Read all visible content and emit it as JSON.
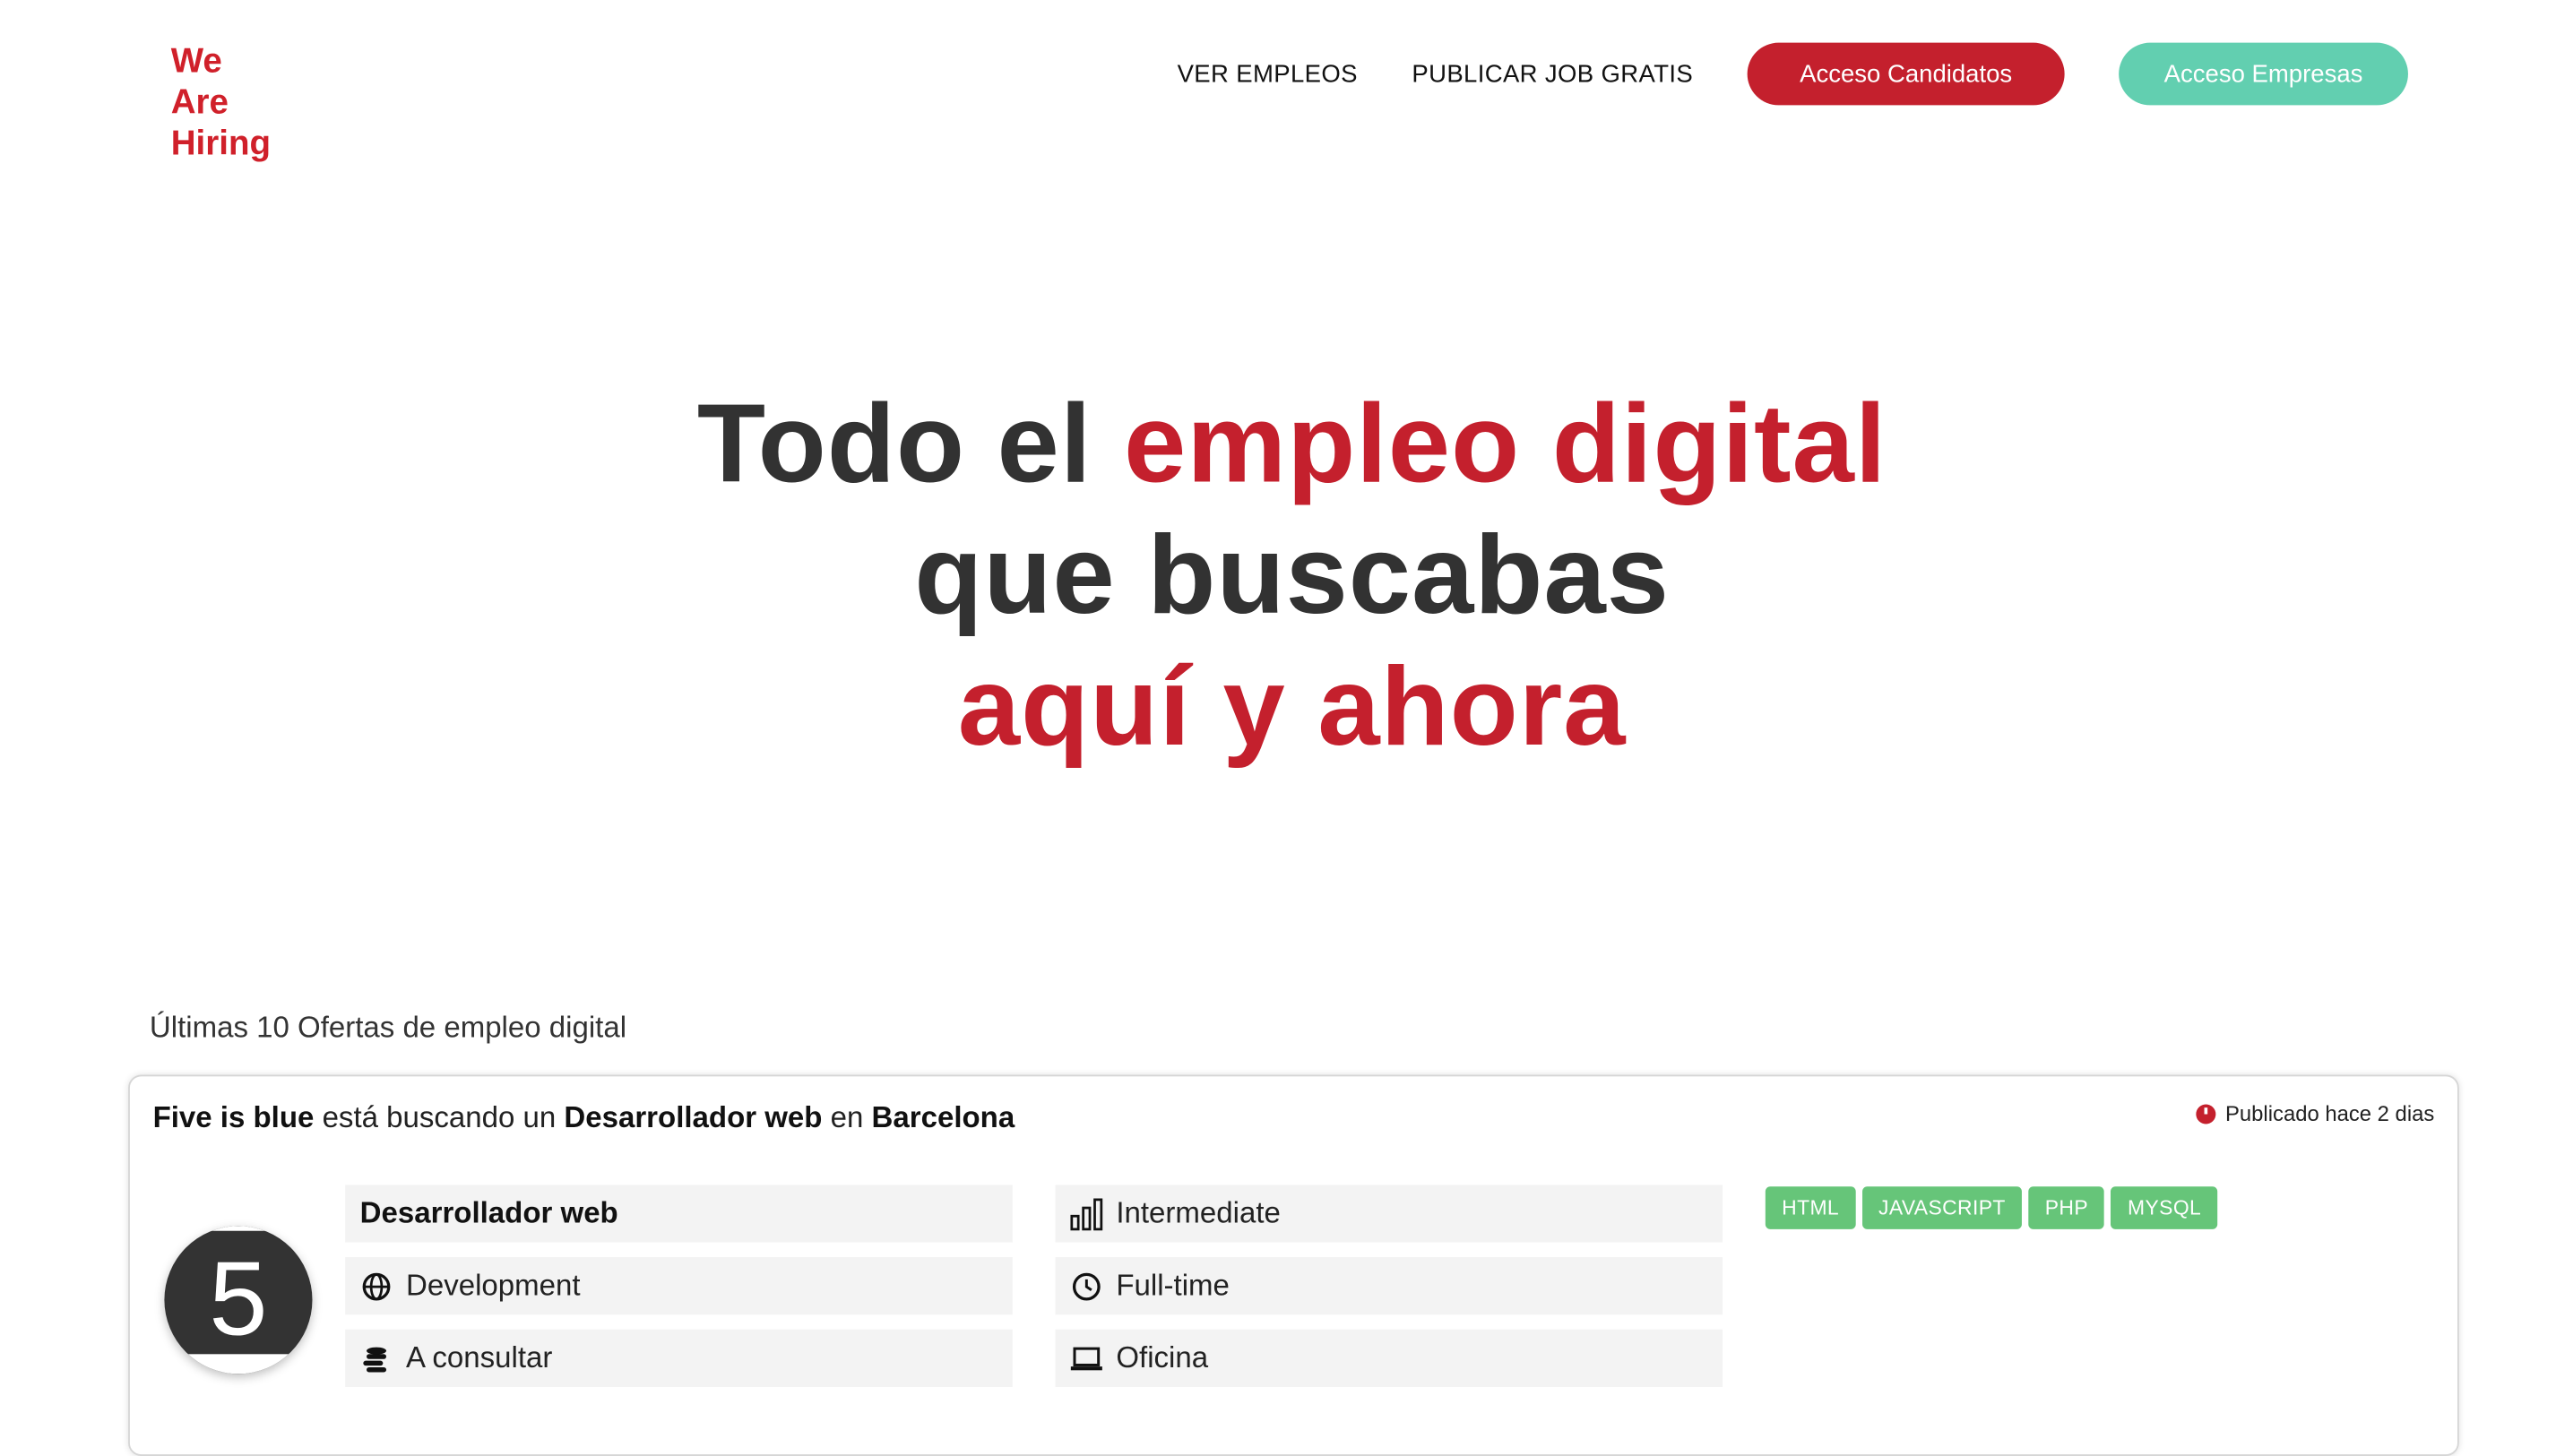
{
  "logo": {
    "line1": "We",
    "line2": "Are",
    "line3": "Hiring"
  },
  "nav": {
    "link1": "VER EMPLEOS",
    "link2": "PUBLICAR JOB GRATIS",
    "btn_candidates": "Acceso Candidatos",
    "btn_companies": "Acceso Empresas"
  },
  "hero": {
    "line1_dark": "Todo el ",
    "line1_accent": "empleo digital",
    "line2": "que buscabas",
    "line3": "aquí y ahora"
  },
  "listing": {
    "section_title": "Últimas 10 Ofertas de empleo digital",
    "jobs": [
      {
        "company": "Five is blue",
        "connector1": " está buscando un ",
        "role": "Desarrollador web",
        "connector2": " en ",
        "city": "Barcelona",
        "published": "Publicado hace 2 dias",
        "logo_text": "5",
        "title": "Desarrollador web",
        "category": "Development",
        "salary": "A consultar",
        "level": "Intermediate",
        "schedule": "Full-time",
        "workplace": "Oficina",
        "tags": [
          "HTML",
          "JAVASCRIPT",
          "PHP",
          "MYSQL"
        ]
      }
    ]
  },
  "colors": {
    "brand_red": "#c4202d",
    "teal": "#62cfb0",
    "tag_green": "#66c579",
    "hero_dark": "#323232"
  },
  "icons": {
    "clock": "clock-icon",
    "level": "bar-chart-icon",
    "globe": "globe-icon",
    "coins": "coins-icon",
    "laptop": "laptop-icon"
  }
}
